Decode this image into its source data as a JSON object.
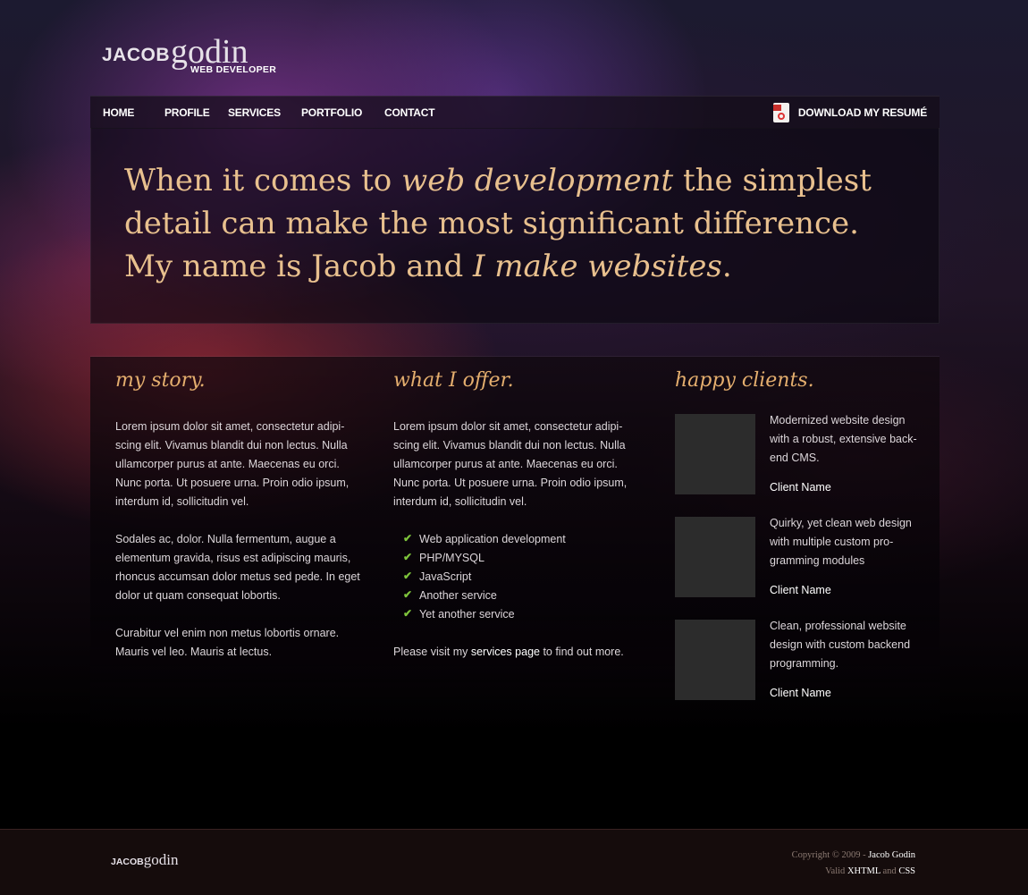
{
  "logo": {
    "first": "JACOB",
    "last": "godin",
    "tagline": "WEB DEVELOPER"
  },
  "nav": {
    "items": [
      {
        "label": "HOME"
      },
      {
        "label": "PROFILE"
      },
      {
        "label": "SERVICES"
      },
      {
        "label": "PORTFOLIO"
      },
      {
        "label": "CONTACT"
      }
    ],
    "resume_label": "DOWNLOAD MY RESUMÉ"
  },
  "hero": {
    "p1": "When it comes to ",
    "p2": "web development",
    "p3": " the simplest detail can make the most significant difference. My name is Jacob and ",
    "p4": "I make websites",
    "p5": "."
  },
  "story": {
    "title": "my story.",
    "paragraphs": [
      "Lorem ipsum dolor sit amet, consectetur adipi-scing elit. Vivamus blandit dui non lectus. Nulla ullamcorper purus at ante. Maecenas eu orci. Nunc porta. Ut posuere urna. Proin odio ipsum, interdum id, sollicitudin vel.",
      "Sodales ac, dolor. Nulla fermentum, augue a elementum gravida, risus est adipiscing mauris, rhoncus accumsan dolor metus sed pede. In eget dolor ut quam consequat lobortis.",
      "Curabitur vel enim non metus lobortis ornare. Mauris vel leo. Mauris at lectus."
    ]
  },
  "offer": {
    "title": "what I offer.",
    "intro": "Lorem ipsum dolor sit amet, consectetur adipi-scing elit. Vivamus blandit dui non lectus. Nulla ullamcorper purus at ante. Maecenas eu orci. Nunc porta. Ut posuere urna. Proin odio ipsum, interdum id, sollicitudin vel.",
    "services": [
      "Web application development",
      "PHP/MYSQL",
      "JavaScript",
      "Another service",
      "Yet another service"
    ],
    "outro_before": "Please visit my ",
    "outro_link": "services page",
    "outro_after": " to find out more."
  },
  "clients": {
    "title": "happy clients.",
    "items": [
      {
        "desc": "Modernized website design with a robust, extensive back-end CMS.",
        "name": "Client Name"
      },
      {
        "desc": "Quirky, yet clean web design with multiple custom pro-gramming modules",
        "name": "Client Name"
      },
      {
        "desc": "Clean, professional website design with custom backend programming.",
        "name": "Client Name"
      }
    ]
  },
  "footer": {
    "logo_first": "JACOB",
    "logo_last": "godin",
    "copyright": "Copyright © 2009 - ",
    "author": "Jacob Godin",
    "valid": "Valid ",
    "xhtml": "XHTML",
    "and": " and ",
    "css": "CSS"
  },
  "colors": {
    "accent": "#e4ae6e",
    "hero_text": "#e8c08e",
    "check": "#7ec43b",
    "thumb": "#2c2c2c"
  },
  "icons": [
    "pdf-icon",
    "check-icon"
  ]
}
